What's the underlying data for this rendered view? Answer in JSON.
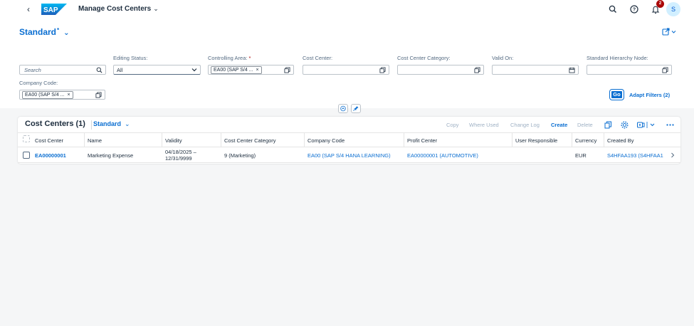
{
  "shell": {
    "back_icon": "chevron-left-icon",
    "logo_text": "SAP",
    "app_title": "Manage Cost Centers",
    "notification_count": "2",
    "avatar_initial": "S"
  },
  "header": {
    "variant_name": "Standard",
    "variant_modified_marker": "*"
  },
  "filters": {
    "search_placeholder": "Search",
    "editing_status": {
      "label": "Editing Status:",
      "value": "All"
    },
    "controlling_area": {
      "label": "Controlling Area:",
      "required_marker": "*",
      "token": "EA00 (SAP S/4 ..."
    },
    "cost_center": {
      "label": "Cost Center:"
    },
    "cost_center_category": {
      "label": "Cost Center Category:"
    },
    "valid_on": {
      "label": "Valid On:"
    },
    "standard_hierarchy_node": {
      "label": "Standard Hierarchy Node:"
    },
    "company_code": {
      "label": "Company Code:",
      "token": "EA00 (SAP S/4 ..."
    },
    "go_label": "Go",
    "adapt_filters_label": "Adapt Filters (2)"
  },
  "table": {
    "title": "Cost Centers (1)",
    "variant": "Standard",
    "toolbar": {
      "copy": "Copy",
      "where_used": "Where Used",
      "change_log": "Change Log",
      "create": "Create",
      "delete": "Delete"
    },
    "columns": [
      "Cost Center",
      "Name",
      "Validity",
      "Cost Center Category",
      "Company Code",
      "Profit Center",
      "User Responsible",
      "Currency",
      "Created By"
    ],
    "rows": [
      {
        "cost_center": "EA00000001",
        "name": "Marketing Expense",
        "validity_from": "04/18/2025 –",
        "validity_to": "12/31/9999",
        "category": "9 (Marketing)",
        "company_code": "EA00 (SAP S/4 HANA LEARNING)",
        "profit_center": "EA00000001 (AUTOMOTIVE)",
        "user_responsible": "",
        "currency": "EUR",
        "created_by": "S4HFAA193 (S4HFAA1"
      }
    ]
  },
  "colors": {
    "accent": "#0a6ed1",
    "text": "#1d2d3e",
    "badge": "#aa0808",
    "background": "#f5f6f7"
  }
}
